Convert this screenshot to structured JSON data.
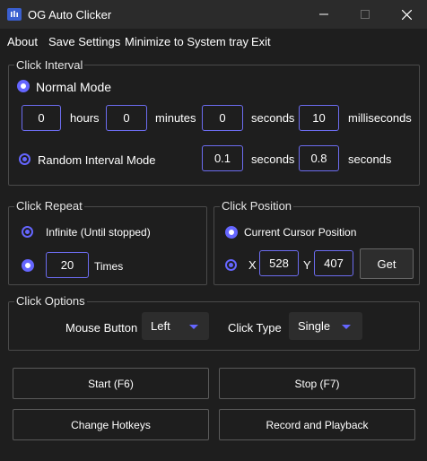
{
  "window": {
    "title": "OG Auto Clicker"
  },
  "menu": [
    {
      "label": "About"
    },
    {
      "label": "Save Settings"
    },
    {
      "label": "Minimize to System tray"
    },
    {
      "label": "Exit"
    }
  ],
  "click_interval": {
    "title": "Click Interval",
    "normal_mode": {
      "label": "Normal Mode",
      "selected": true,
      "hours": "0",
      "hours_label": "hours",
      "minutes": "0",
      "minutes_label": "minutes",
      "seconds": "0",
      "seconds_label": "seconds",
      "milliseconds": "10",
      "milliseconds_label": "milliseconds"
    },
    "random_mode": {
      "label": "Random Interval Mode",
      "selected": false,
      "min": "0.1",
      "min_label": "seconds",
      "max": "0.8",
      "max_label": "seconds"
    }
  },
  "click_repeat": {
    "title": "Click Repeat",
    "infinite_label": "Infinite (Until stopped)",
    "infinite_selected": false,
    "times_value": "20",
    "times_label": "Times",
    "times_selected": true
  },
  "click_position": {
    "title": "Click Position",
    "current_label": "Current Cursor Position",
    "current_selected": true,
    "custom_selected": false,
    "x_label": "X",
    "x_value": "528",
    "y_label": "Y",
    "y_value": "407",
    "get_label": "Get"
  },
  "click_options": {
    "title": "Click Options",
    "mouse_button_label": "Mouse Button",
    "mouse_button_value": "Left",
    "click_type_label": "Click Type",
    "click_type_value": "Single"
  },
  "buttons": {
    "start": "Start (F6)",
    "stop": "Stop (F7)",
    "change_hotkeys": "Change Hotkeys",
    "record_playback": "Record and Playback"
  },
  "colors": {
    "accent": "#6566ff",
    "background": "#1e1e1e",
    "titlebar": "#2b2b2b"
  }
}
